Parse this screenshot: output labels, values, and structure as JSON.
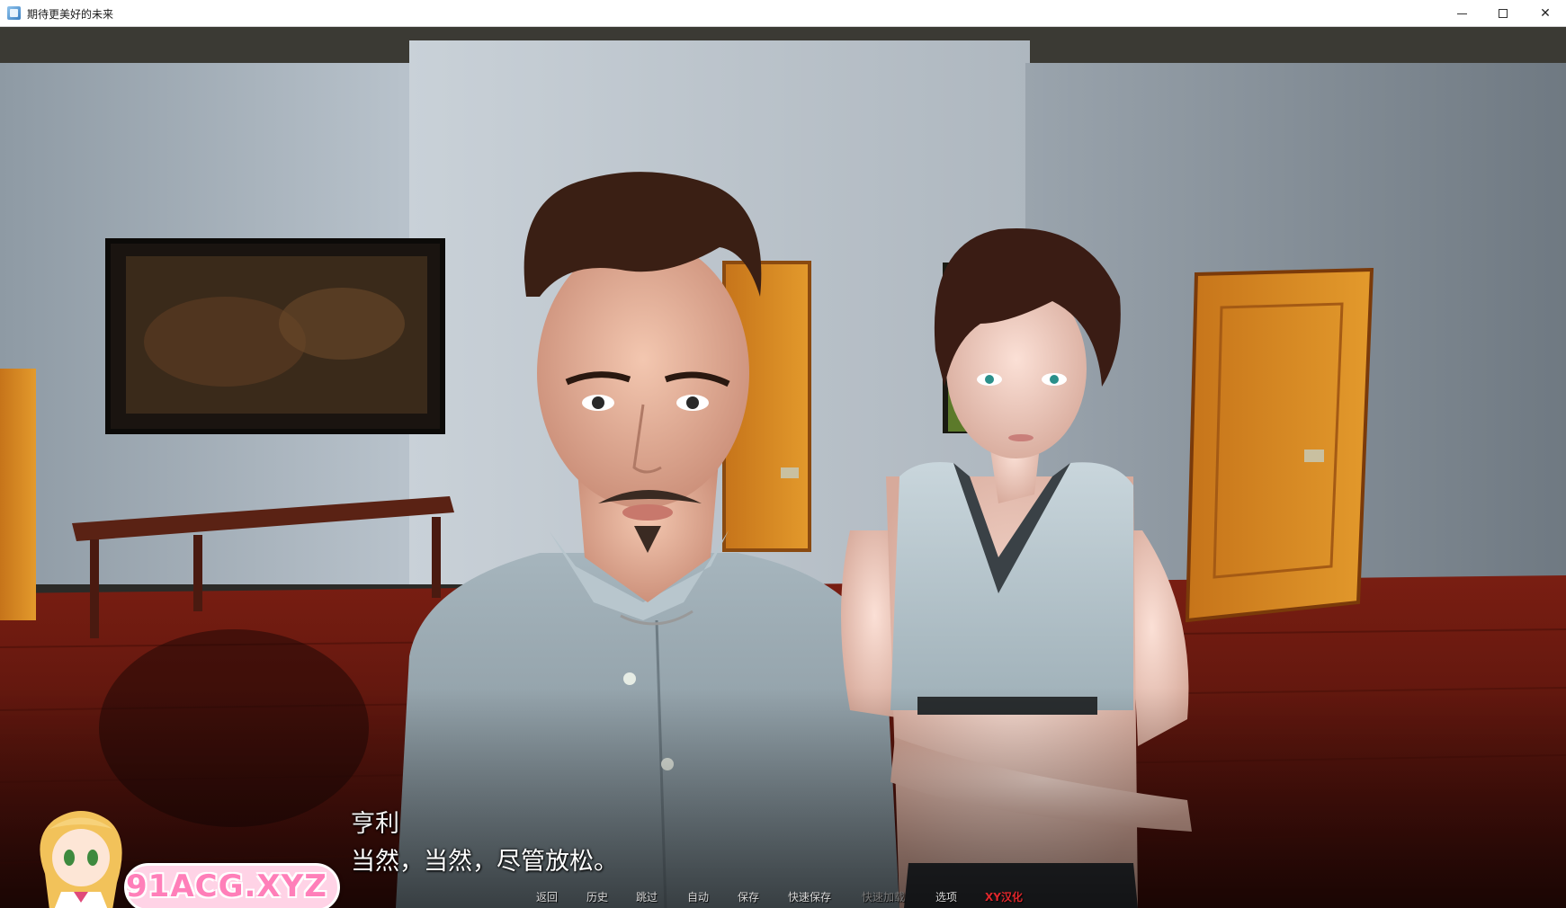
{
  "window": {
    "title": "期待更美好的未来",
    "controls": {
      "minimize": "—",
      "maximize": "□",
      "close": "✕"
    }
  },
  "dialogue": {
    "speaker": "亨利",
    "text": "当然，当然，尽管放松。"
  },
  "watermark": {
    "text": "91ACG.XYZ"
  },
  "quick_menu": {
    "back": "返回",
    "history": "历史",
    "skip": "跳过",
    "auto": "自动",
    "save": "保存",
    "quick_save": "快速保存",
    "quick_load": "快速加载",
    "options": "选项",
    "credit": "XY汉化"
  },
  "colors": {
    "dialogue_text": "#ffffff",
    "menu_text": "#d9d9d9",
    "menu_disabled": "#7a7a7a",
    "credit_accent": "#e0262b",
    "watermark_pink": "#ff7fb9"
  }
}
